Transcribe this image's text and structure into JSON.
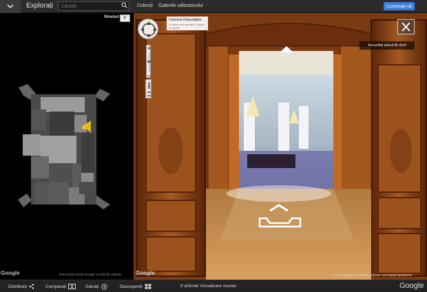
{
  "header": {
    "brand": "Explorați",
    "search_placeholder": "Căutați",
    "nav": [
      "Colecții",
      "Galeriile utilizatorului"
    ],
    "signin_label": "Conectați-vă"
  },
  "map": {
    "levels_label": "Niveluri",
    "level_value": "P",
    "google_logo": "Google",
    "credits": "Date hartă ©2016 Google   Condiții de utilizare"
  },
  "pano": {
    "place_title": "Camera Deputaților",
    "place_subtitle": "Imagine mai aproape? Afișați fotografii",
    "hide_plan_label": "Ascundeți planul de nivel",
    "google_logo": "Google",
    "credits": "© 2016 Google   Condiții de utilizare   Semnalați o problemă"
  },
  "footer": {
    "items": [
      "Distribuiți",
      "Comparați",
      "Salvați",
      "Descoperiți"
    ],
    "status": "0 articole Vizualizare muzeu",
    "google": "Google"
  },
  "colors": {
    "accent": "#3b7fe0",
    "topbar": "#2b2b2b",
    "map_bg": "#000000",
    "map_floor": "#555555",
    "wood": "#8a4a1c"
  }
}
